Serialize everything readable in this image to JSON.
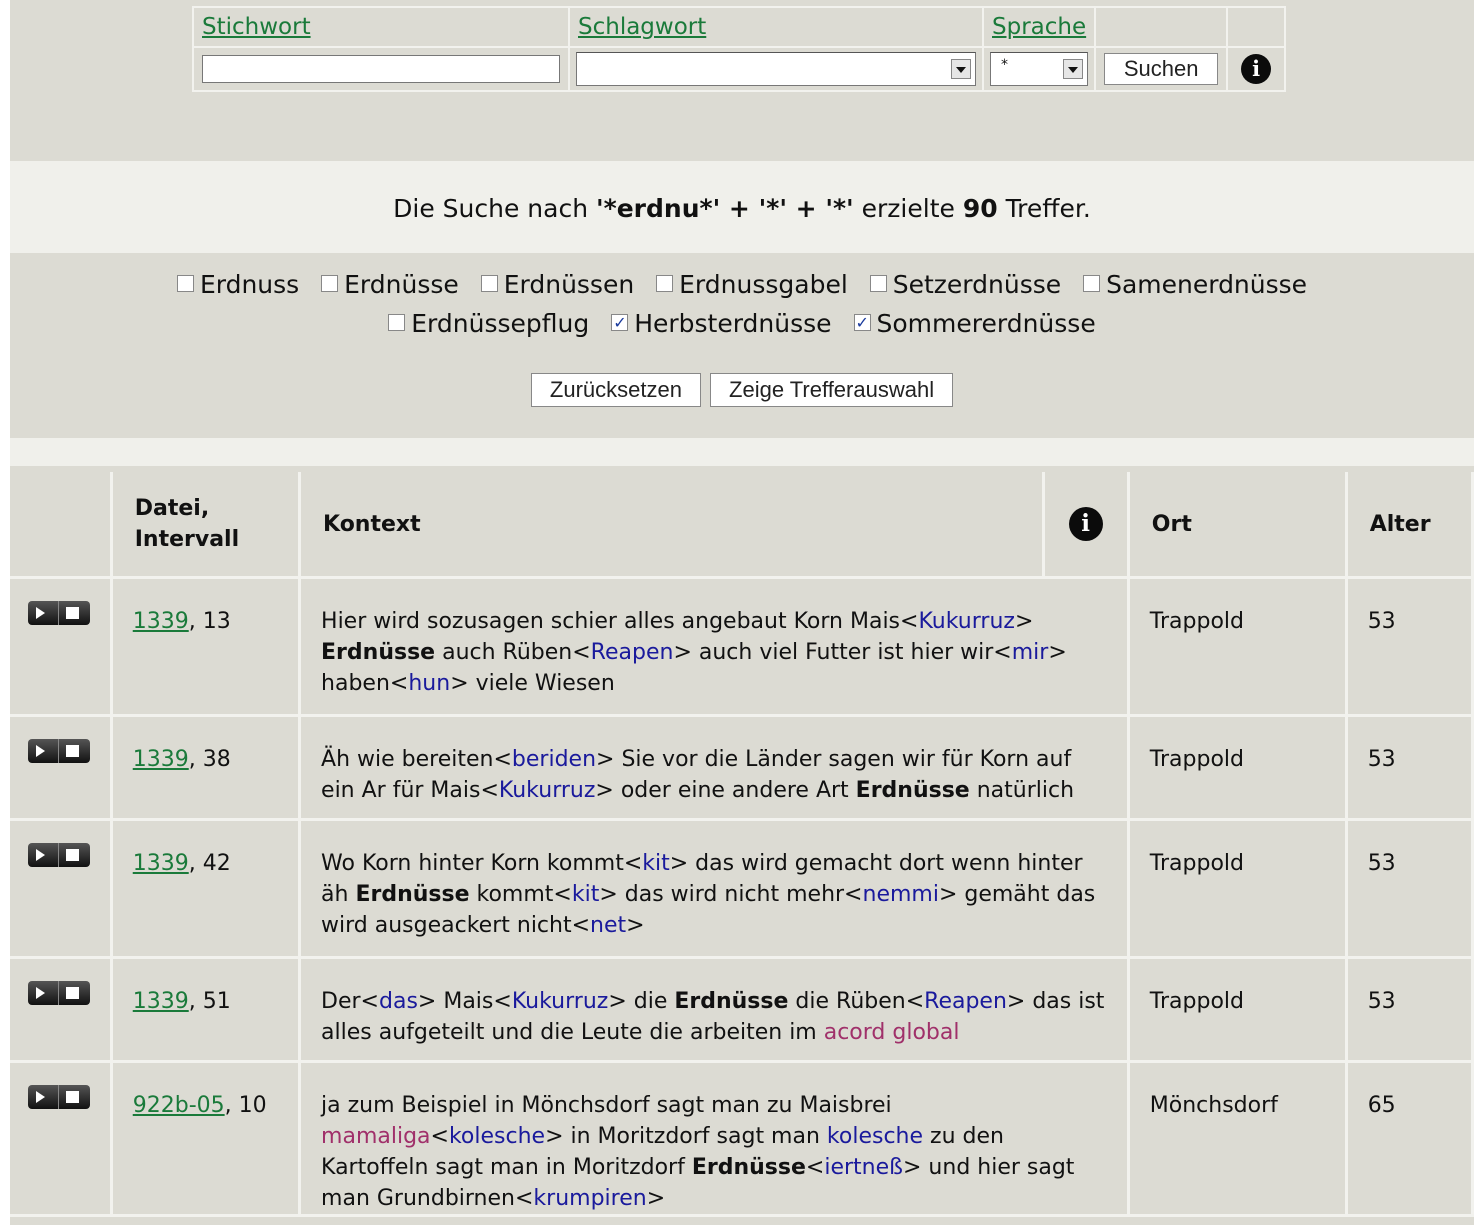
{
  "search": {
    "headers": {
      "stichwort": "Stichwort",
      "schlagwort": "Schlagwort",
      "sprache": "Sprache"
    },
    "stichwort_value": "",
    "schlagwort_value": "",
    "sprache_value": "*",
    "submit_label": "Suchen",
    "info_icon": "info-icon"
  },
  "summary": {
    "prefix": "Die Suche nach ",
    "query": "'*erdnu*' + '*' + '*'",
    "middle": " erzielte ",
    "count": "90",
    "suffix": " Treffer."
  },
  "filters": [
    {
      "label": "Erdnuss",
      "checked": false
    },
    {
      "label": "Erdnüsse",
      "checked": false
    },
    {
      "label": "Erdnüssen",
      "checked": false
    },
    {
      "label": "Erdnussgabel",
      "checked": false
    },
    {
      "label": "Setzerdnüsse",
      "checked": false
    },
    {
      "label": "Samenerdnüsse",
      "checked": false
    },
    {
      "label": "Erdnüssepflug",
      "checked": false
    },
    {
      "label": "Herbsterdnüsse",
      "checked": true
    },
    {
      "label": "Sommererdnüsse",
      "checked": true
    }
  ],
  "filter_buttons": {
    "reset": "Zurücksetzen",
    "show": "Zeige Trefferauswahl"
  },
  "table": {
    "headers": {
      "file": "Datei, Intervall",
      "context": "Kontext",
      "place": "Ort",
      "age": "Alter"
    },
    "rows": [
      {
        "file": "1339",
        "interval": ", 13",
        "context": [
          {
            "t": "Hier wird sozusagen schier alles angebaut Korn Mais"
          },
          {
            "t": "<"
          },
          {
            "t": "Kukurruz",
            "c": "std"
          },
          {
            "t": "> "
          },
          {
            "t": "Erdnüsse",
            "c": "hilite"
          },
          {
            "t": " auch Rüben<"
          },
          {
            "t": "Reapen",
            "c": "std"
          },
          {
            "t": "> auch viel Futter ist hier wir<"
          },
          {
            "t": "mir",
            "c": "std"
          },
          {
            "t": "> haben<"
          },
          {
            "t": "hun",
            "c": "std"
          },
          {
            "t": "> viele Wiesen"
          }
        ],
        "place": "Trappold",
        "age": "53"
      },
      {
        "file": "1339",
        "interval": ", 38",
        "context": [
          {
            "t": "Äh wie bereiten<"
          },
          {
            "t": "beriden",
            "c": "std"
          },
          {
            "t": "> Sie vor die Länder sagen wir für Korn auf ein Ar für Mais<"
          },
          {
            "t": "Kukurruz",
            "c": "std"
          },
          {
            "t": "> oder eine andere Art "
          },
          {
            "t": "Erdnüsse",
            "c": "hilite"
          },
          {
            "t": " natürlich"
          }
        ],
        "place": "Trappold",
        "age": "53"
      },
      {
        "file": "1339",
        "interval": ", 42",
        "context": [
          {
            "t": "Wo Korn hinter Korn kommt<"
          },
          {
            "t": "kit",
            "c": "std"
          },
          {
            "t": "> das wird gemacht dort wenn hinter äh "
          },
          {
            "t": "Erdnüsse",
            "c": "hilite"
          },
          {
            "t": " kommt<"
          },
          {
            "t": "kit",
            "c": "std"
          },
          {
            "t": "> das wird nicht mehr<"
          },
          {
            "t": "nemmi",
            "c": "std"
          },
          {
            "t": "> gemäht das wird ausgeackert nicht<"
          },
          {
            "t": "net",
            "c": "std"
          },
          {
            "t": ">"
          }
        ],
        "place": "Trappold",
        "age": "53"
      },
      {
        "file": "1339",
        "interval": ", 51",
        "context": [
          {
            "t": "Der<"
          },
          {
            "t": "das",
            "c": "std"
          },
          {
            "t": "> Mais<"
          },
          {
            "t": "Kukurruz",
            "c": "std"
          },
          {
            "t": "> die "
          },
          {
            "t": "Erdnüsse",
            "c": "hilite"
          },
          {
            "t": " die Rüben<"
          },
          {
            "t": "Reapen",
            "c": "std"
          },
          {
            "t": "> das ist alles aufgeteilt und die Leute die arbeiten im "
          },
          {
            "t": "acord global",
            "c": "rom"
          }
        ],
        "place": "Trappold",
        "age": "53"
      },
      {
        "file": "922b-05",
        "interval": ", 10",
        "context": [
          {
            "t": "ja zum Beispiel in Mönchsdorf sagt man zu Maisbrei "
          },
          {
            "t": "mamaliga",
            "c": "rom"
          },
          {
            "t": "<"
          },
          {
            "t": "kolesche",
            "c": "std"
          },
          {
            "t": "> in Moritzdorf sagt man "
          },
          {
            "t": "kolesche",
            "c": "std"
          },
          {
            "t": " zu den Kartoffeln sagt man in Moritzdorf "
          },
          {
            "t": "Erdnüsse",
            "c": "hilite"
          },
          {
            "t": "<"
          },
          {
            "t": "iertneß",
            "c": "std"
          },
          {
            "t": "> und hier sagt man Grundbirnen<"
          },
          {
            "t": "krumpiren",
            "c": "std"
          },
          {
            "t": ">"
          }
        ],
        "place": "Mönchsdorf",
        "age": "65"
      }
    ]
  },
  "play_control_icon": "play-stop-icon"
}
